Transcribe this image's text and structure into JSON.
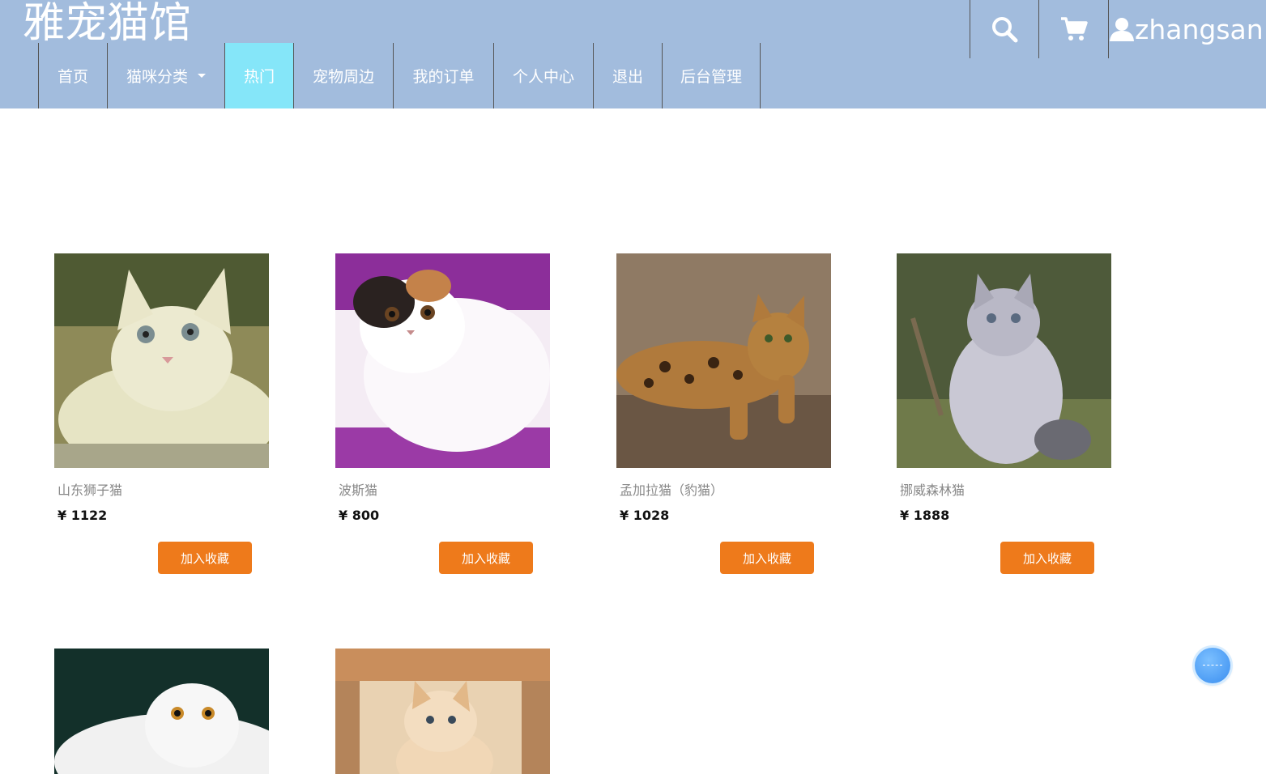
{
  "header": {
    "logo": "雅宠猫馆",
    "username": "zhangsan",
    "icons": {
      "search": "search-icon",
      "cart": "cart-icon",
      "user": "user-icon"
    },
    "colors": {
      "bar": "#a2bcdd",
      "active": "#85e6f9"
    }
  },
  "nav": {
    "items": [
      {
        "label": "首页"
      },
      {
        "label": "猫咪分类"
      },
      {
        "label": "热门"
      },
      {
        "label": "宠物周边"
      },
      {
        "label": "我的订单"
      },
      {
        "label": "个人中心"
      },
      {
        "label": "退出"
      },
      {
        "label": "后台管理"
      }
    ],
    "active_index": 2
  },
  "products": [
    {
      "name": "山东狮子猫",
      "price": "¥ 1122",
      "button": "加入收藏"
    },
    {
      "name": "波斯猫",
      "price": "¥ 800",
      "button": "加入收藏"
    },
    {
      "name": "孟加拉猫（豹猫）",
      "price": "¥ 1028",
      "button": "加入收藏"
    },
    {
      "name": "挪威森林猫",
      "price": "¥ 1888",
      "button": "加入收藏"
    },
    {
      "name": "",
      "price": "",
      "button": ""
    },
    {
      "name": "",
      "price": "",
      "button": ""
    }
  ],
  "accent_color": "#ee7a1b"
}
